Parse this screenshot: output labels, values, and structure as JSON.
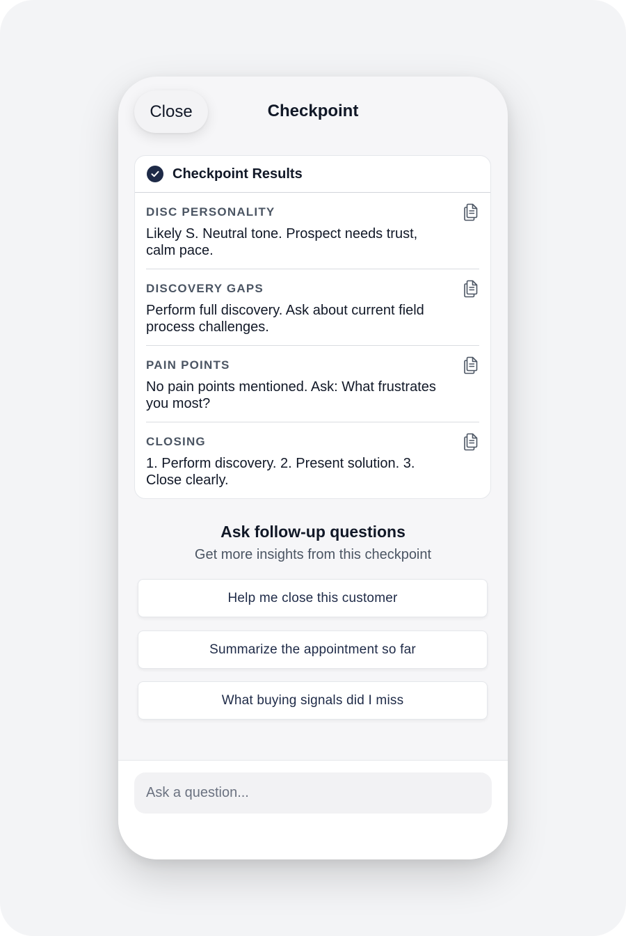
{
  "header": {
    "close_label": "Close",
    "title": "Checkpoint"
  },
  "results": {
    "title": "Checkpoint Results",
    "sections": [
      {
        "label": "DISC PERSONALITY",
        "text": "Likely S. Neutral tone. Prospect needs trust, calm pace."
      },
      {
        "label": "DISCOVERY GAPS",
        "text": "Perform full discovery. Ask about current field process challenges."
      },
      {
        "label": "PAIN POINTS",
        "text": "No pain points mentioned. Ask: What frustrates you most?"
      },
      {
        "label": "CLOSING",
        "text": "1. Perform discovery. 2. Present solution. 3. Close clearly."
      }
    ]
  },
  "followup": {
    "title": "Ask follow-up questions",
    "subtitle": "Get more insights from this checkpoint",
    "suggestions": [
      "Help me close this customer",
      "Summarize the appointment so far",
      "What buying signals did I miss"
    ]
  },
  "input": {
    "value": "",
    "placeholder": "Ask a question..."
  },
  "colors": {
    "accent": "#1e2a47",
    "background": "#f3f4f6",
    "card": "#ffffff"
  },
  "icons": {
    "check": "check-circle-icon",
    "copy": "copy-icon"
  }
}
